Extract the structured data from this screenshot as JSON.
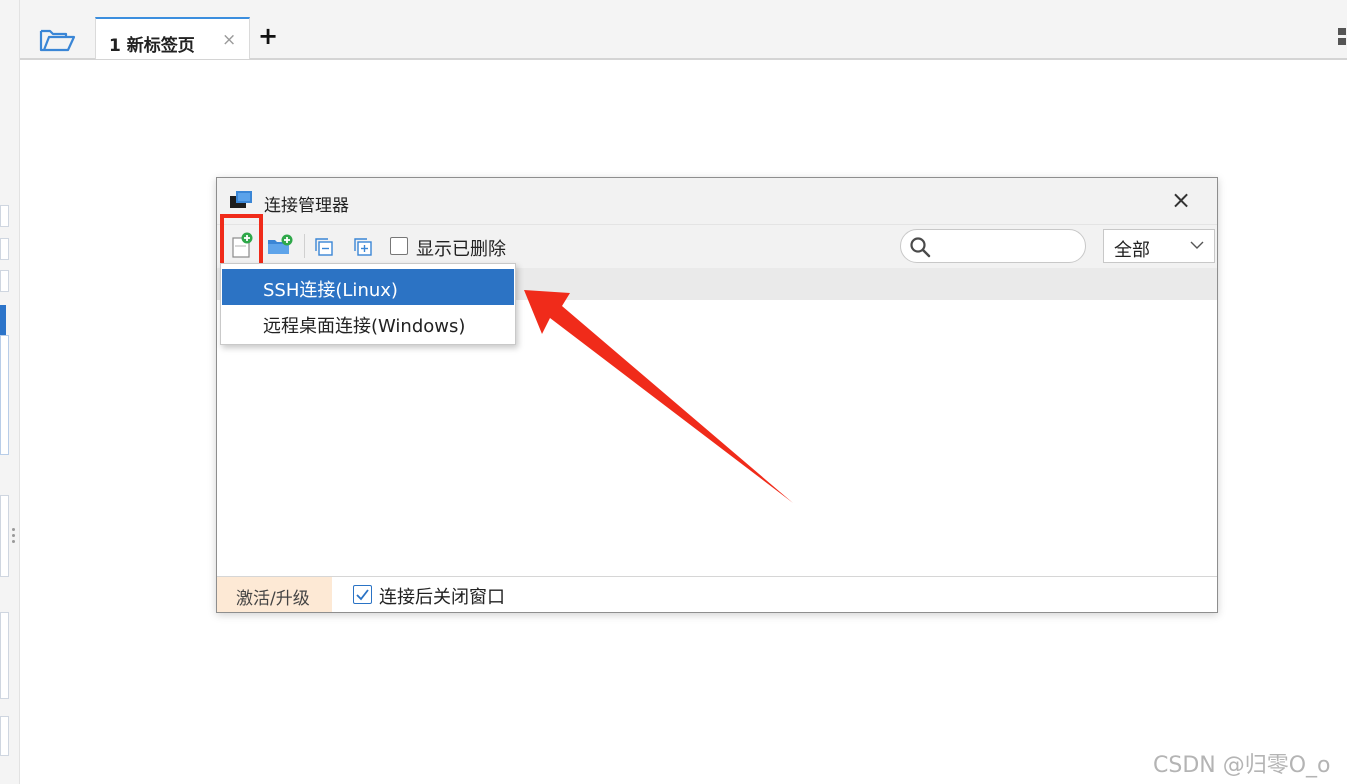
{
  "tabs": [
    {
      "label": "1 新标签页",
      "close_glyph": "×"
    }
  ],
  "tab_add_glyph": "+",
  "dialog": {
    "title": "连接管理器",
    "close_glyph": "×",
    "toolbar": {
      "show_deleted_label": "显示已删除",
      "show_deleted_checked": false,
      "search_placeholder": "",
      "search_value": "",
      "filter_selected": "全部"
    },
    "new_menu": {
      "items": [
        {
          "label": "SSH连接(Linux)",
          "selected": true
        },
        {
          "label": "远程桌面连接(Windows)",
          "selected": false
        }
      ]
    },
    "footer": {
      "activate_label": "激活/升级",
      "close_after_connect_label": "连接后关闭窗口",
      "close_after_connect_checked": true
    }
  },
  "watermark": "CSDN @归零O_o",
  "colors": {
    "accent": "#2c73c4",
    "highlight_red": "#f02b1a",
    "activate_bg": "#fde9d5"
  },
  "icons": {
    "tabbar_folder": "folder-open-icon",
    "toolbar_new": "new-session-icon",
    "toolbar_new_folder": "new-folder-icon",
    "toolbar_collapse": "collapse-all-icon",
    "toolbar_expand": "expand-all-icon",
    "search": "search-icon",
    "dialog": "terminal-app-icon"
  }
}
